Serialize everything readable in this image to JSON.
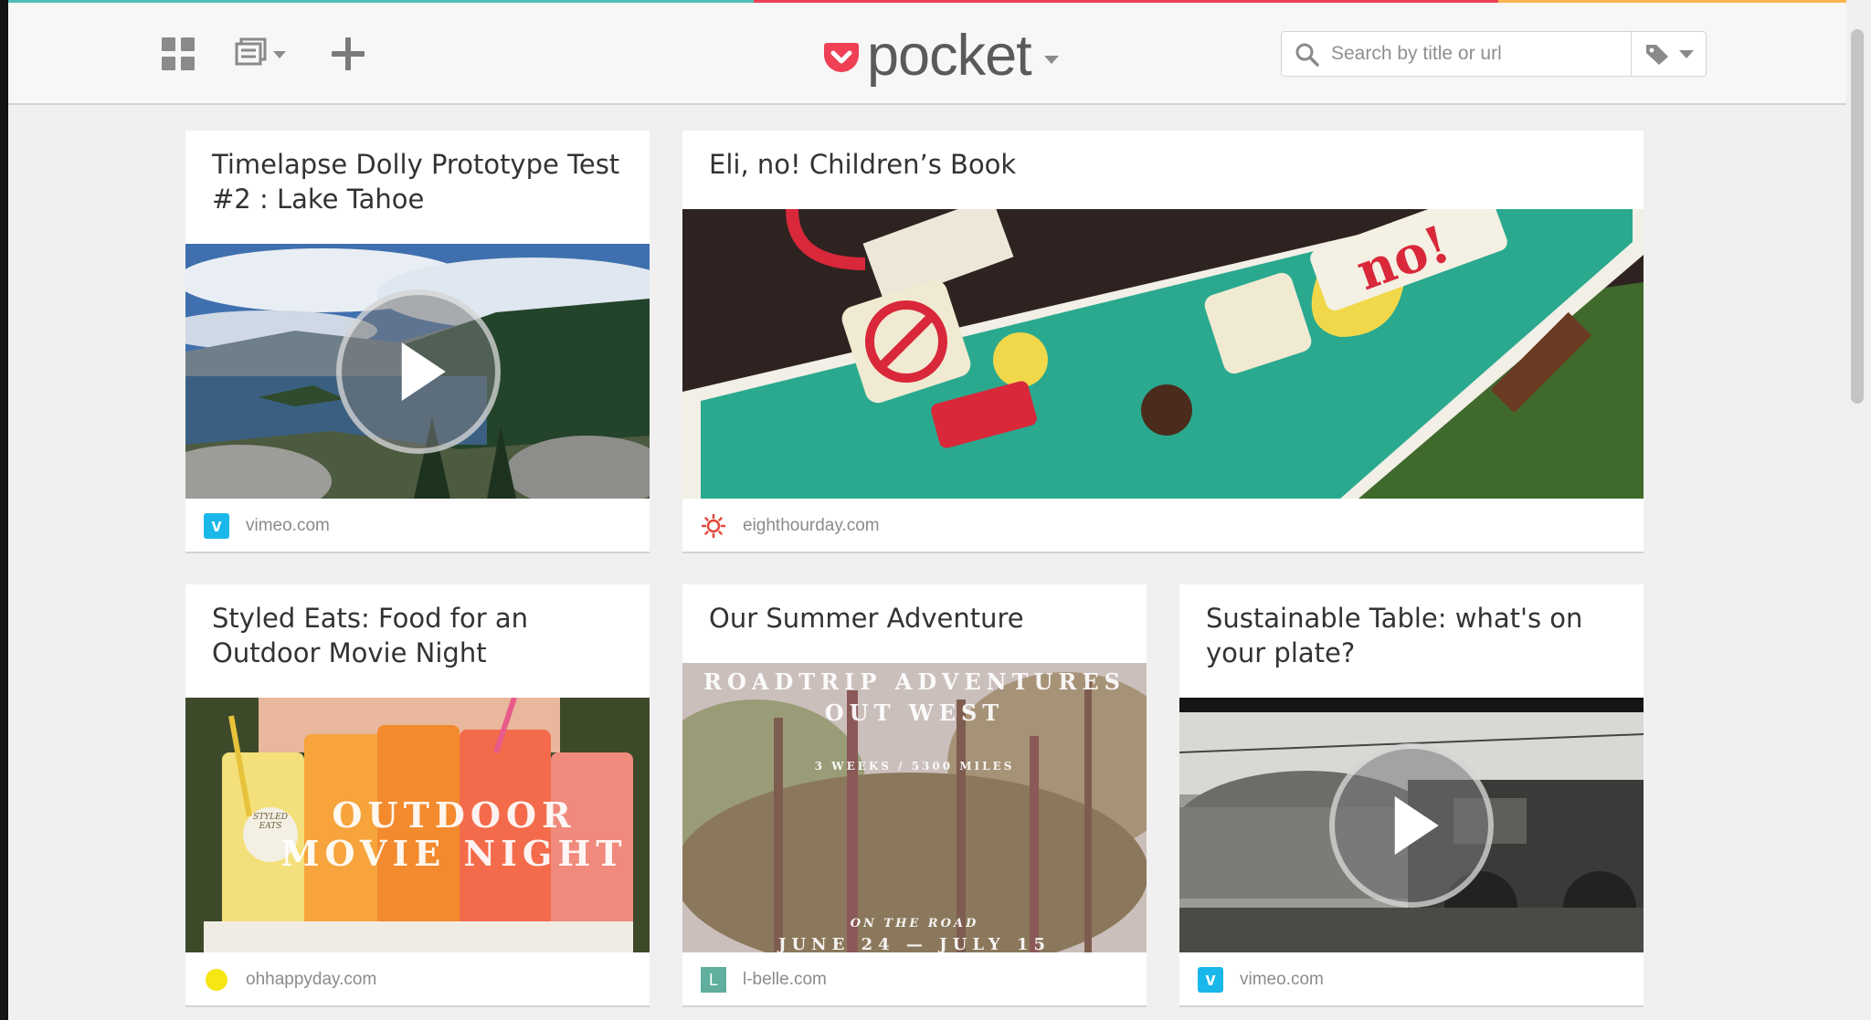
{
  "brand": {
    "name": "pocket"
  },
  "search": {
    "placeholder": "Search by title or url"
  },
  "icons": {
    "view_toggle": "grid-icon",
    "list": "list-icon",
    "add": "plus-icon",
    "search": "search-icon",
    "tag": "tag-icon",
    "video": "play-icon"
  },
  "colors": {
    "brand_red": "#ef4056",
    "accent_teal": "#50bcb6",
    "accent_orange": "#fcb64e",
    "vimeo": "#1ab7ea"
  },
  "items": [
    {
      "title": "Timelapse Dolly Prototype Test #2 : Lake Tahoe",
      "domain": "vimeo.com",
      "favicon": "vimeo-icon",
      "video": true
    },
    {
      "title": "Eli, no! Children’s Book",
      "domain": "eighthourday.com",
      "favicon": "sun-icon",
      "video": false,
      "thumb_text": "no!"
    },
    {
      "title": "Styled Eats: Food for an Outdoor Movie Night",
      "domain": "ohhappyday.com",
      "favicon": "yellow-dot-icon",
      "video": false,
      "thumb_lines": [
        "OUTDOOR",
        "MOVIE NIGHT"
      ],
      "thumb_badge": "STYLED EATS"
    },
    {
      "title": "Our Summer Adventure",
      "domain": "l-belle.com",
      "favicon": "letter-l-icon",
      "favicon_letter": "L",
      "video": false,
      "thumb_lines": [
        "ROADTRIP ADVENTURES",
        "OUT WEST",
        "3 WEEKS / 5300 MILES",
        "ON THE ROAD",
        "JUNE 24 — JULY 15"
      ]
    },
    {
      "title": "Sustainable Table: what's on your plate?",
      "domain": "vimeo.com",
      "favicon": "vimeo-icon",
      "video": true
    }
  ]
}
